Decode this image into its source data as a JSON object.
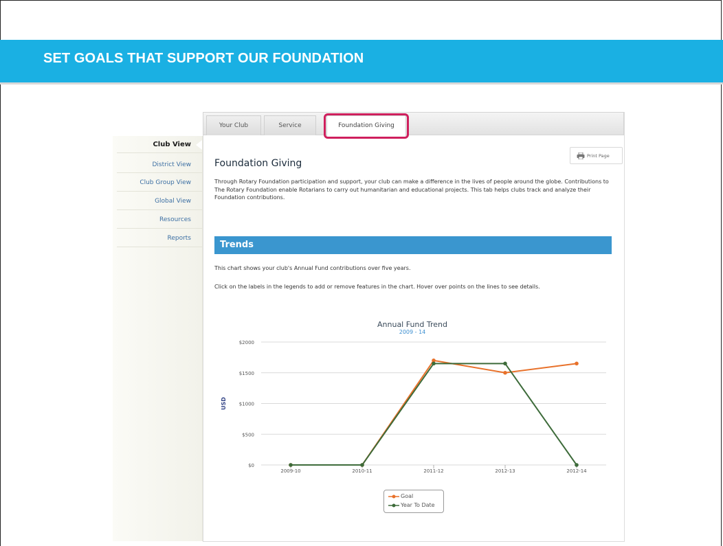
{
  "slide": {
    "title": "SET GOALS THAT SUPPORT OUR FOUNDATION"
  },
  "tabs": [
    {
      "label": "Your Club"
    },
    {
      "label": "Service"
    },
    {
      "label": "Foundation Giving",
      "active": true
    }
  ],
  "sidebar": {
    "items": [
      {
        "label": "Club View",
        "active": true
      },
      {
        "label": "District View"
      },
      {
        "label": "Club Group View"
      },
      {
        "label": "Global View"
      },
      {
        "label": "Resources"
      },
      {
        "label": "Reports"
      }
    ]
  },
  "print_button": {
    "label": "Print Page",
    "icon": "printer-icon"
  },
  "main": {
    "heading": "Foundation Giving",
    "intro": "Through Rotary Foundation participation and support, your club can make a difference in the lives of people around the globe. Contributions to The Rotary Foundation enable Rotarians to carry out humanitarian and educational projects. This tab helps clubs track and analyze their Foundation contributions.",
    "section_title": "Trends",
    "chart_desc": "This chart shows your club's Annual Fund contributions over five years.",
    "chart_hint": "Click on the labels in the legends to add or remove features in the chart. Hover over points on the lines to see details."
  },
  "colors": {
    "banner": "#1ab0e3",
    "section_bar": "#3a96cf",
    "highlight": "#cf1f5d",
    "goal": "#e8712a",
    "ytd": "#3d6b3a"
  },
  "chart_data": {
    "type": "line",
    "title": "Annual Fund Trend",
    "subtitle": "2009 - 14",
    "xlabel": "",
    "ylabel": "USD",
    "categories": [
      "2009-10",
      "2010-11",
      "2011-12",
      "2012-13",
      "2012-14"
    ],
    "y_ticks": [
      "$0",
      "$500",
      "$1000",
      "$1500",
      "$2000"
    ],
    "ylim": [
      0,
      2000
    ],
    "grid": true,
    "legend_position": "bottom-center",
    "series": [
      {
        "name": "Goal",
        "color": "#e8712a",
        "values": [
          0,
          0,
          1700,
          1500,
          1650
        ]
      },
      {
        "name": "Year To Date",
        "color": "#3d6b3a",
        "values": [
          0,
          0,
          1650,
          1650,
          0
        ]
      }
    ]
  }
}
